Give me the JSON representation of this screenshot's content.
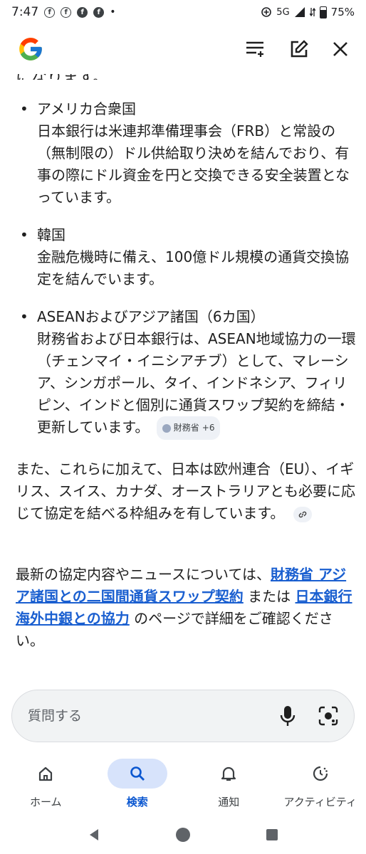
{
  "status_bar": {
    "time": "7:47",
    "fb_glyph": "f",
    "dot": "•",
    "network": "5G",
    "battery": "75%"
  },
  "header": {
    "logo": "google-g-logo",
    "actions": [
      "list-add-icon",
      "edit-icon",
      "close-icon"
    ]
  },
  "content": {
    "cut_off_text": "になります。",
    "bullets": [
      {
        "title": "アメリカ合衆国",
        "body": "日本銀行は米連邦準備理事会（FRB）と常設の（無制限の）ドル供給取り決めを結んでおり、有事の際にドル資金を円と交換できる安全装置となっています。"
      },
      {
        "title": "韓国",
        "body": "金融危機時に備え、100億ドル規模の通貨交換協定を結んでいます。"
      },
      {
        "title": "ASEANおよびアジア諸国（6カ国）",
        "body": "財務省および日本銀行は、ASEAN地域協力の一環（チェンマイ・イニシアチブ）として、マレーシア、シンガポール、タイ、インドネシア、フィリピン、インドと個別に通貨スワップ契約を締結・更新しています。",
        "source_chip": "財務省",
        "source_more": "+6"
      }
    ],
    "para1": "また、これらに加えて、日本は欧州連合（EU）、イギリス、スイス、カナダ、オーストラリアとも必要に応じて協定を結べる枠組みを有しています。",
    "para2": {
      "prefix": "最新の協定内容やニュースについては、",
      "link1": "財務省 アジア諸国との二国間通貨スワップ契約",
      "middle": " または ",
      "link2": "日本銀行 海外中銀との協力",
      "suffix": " のページで詳細をご確認ください。"
    }
  },
  "ask_bar": {
    "placeholder": "質問する"
  },
  "bottom_nav": [
    {
      "label": "ホーム",
      "icon": "home-icon",
      "active": false
    },
    {
      "label": "検索",
      "icon": "search-icon",
      "active": true
    },
    {
      "label": "通知",
      "icon": "bell-icon",
      "active": false
    },
    {
      "label": "アクティビティ",
      "icon": "activity-icon",
      "active": false
    }
  ],
  "colors": {
    "link": "#1a5fd0",
    "active_nav_bg": "#d7e3fb",
    "active_nav_text": "#0b57d0",
    "chip_bg": "#eef1f6"
  }
}
